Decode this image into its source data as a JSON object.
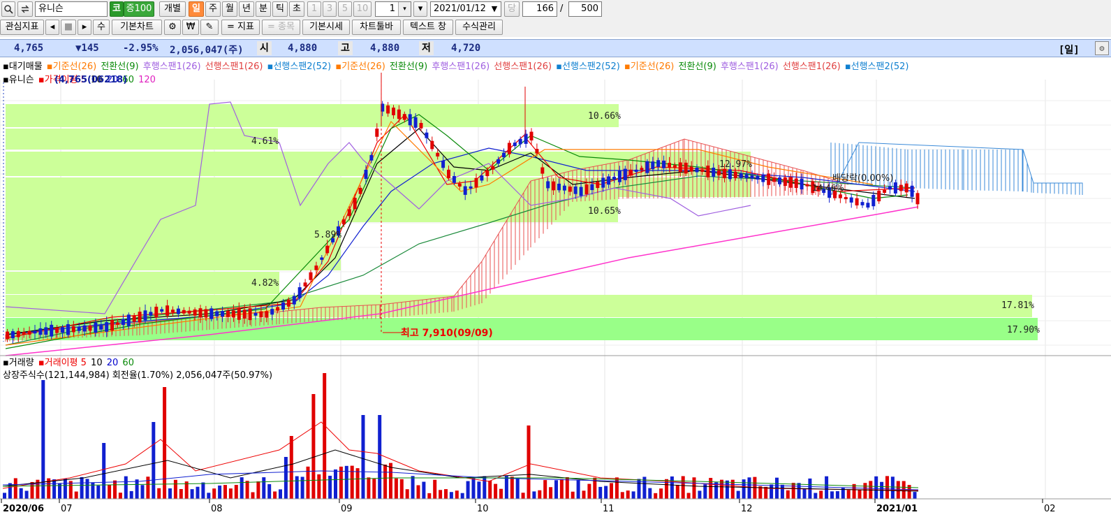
{
  "toolbar1": {
    "stock_name": "유니슨",
    "market_badge": "코",
    "margin_badge": "증100",
    "mode_label": "개별",
    "periods": [
      "일",
      "주",
      "월",
      "년",
      "분",
      "틱",
      "초"
    ],
    "tick_buttons": [
      "1",
      "3",
      "5",
      "10"
    ],
    "interval_value": "1",
    "date_value": "2021/01/12",
    "current_label": "당",
    "count_value": "166",
    "slash": "/",
    "total_value": "500"
  },
  "toolbar2": {
    "items": [
      "관심지표",
      "◂",
      "■",
      "▸",
      "수",
      "기본차트",
      "⚙",
      "₩",
      "🔧",
      "= 지표",
      "= 종목",
      "기본시세",
      "차트툴바",
      "텍스트 창",
      "수식관리"
    ]
  },
  "quote": {
    "price": "4,765",
    "change": "▼145",
    "change_rate": "-2.95%",
    "volume": "2,056,047(주)",
    "open_label": "시",
    "open": "4,880",
    "high_label": "고",
    "high": "4,880",
    "low_label": "저",
    "low": "4,720",
    "period_tag": "[일]"
  },
  "legend": {
    "line1": [
      "▪대기매물",
      "▪기준선(26)",
      "전환선(9)",
      "후행스팬1(26)",
      "선행스팬1(26)",
      "▪선행스팬2(52)",
      "▪기준선(26)",
      "전환선(9)",
      "후행스팬1(26)",
      "선행스팬1(26)",
      "▪선행스팬2(52)",
      "▪기준선(26)",
      "전환선(9)",
      "후행스팬1(26)",
      "선행스팬1(26)",
      "▪선행스팬2(52)"
    ],
    "line2": [
      "▪유니슨",
      "▪가격이평 5",
      "10",
      "20",
      "60",
      "120"
    ],
    "line2_overlay": "(4,765(06218)"
  },
  "volume_legend": {
    "line1": [
      "▪거래량",
      "▪거래이평 5",
      "10",
      "20",
      "60"
    ],
    "line2": "상장주식수(121,144,984) 회전율(1.70%) 2,056,047주(50.97%)"
  },
  "annotations": {
    "high_marker": "최고 7,910(09/09)",
    "dividend": "배당락(0.00%)",
    "overlay_pct": "14.46%"
  },
  "chart_data": {
    "type": "candlestick",
    "price_range": [
      4000,
      8000
    ],
    "volume_bands": [
      {
        "pct": "17.90%"
      },
      {
        "pct": "17.81%"
      },
      {
        "pct": "4.82%"
      },
      {
        "pct": "5.89%"
      },
      {
        "pct": "10.65%"
      },
      {
        "pct": "12.97%"
      },
      {
        "pct": "4.61%"
      },
      {
        "pct": "10.66%"
      }
    ],
    "x_axis_labels": [
      "2020/06",
      "07",
      "08",
      "09",
      "10",
      "11",
      "12",
      "2021/01",
      "02"
    ],
    "colors": {
      "up": "#e00000",
      "down": "#1020d0",
      "band": "#ccff99",
      "band_strong": "#99ff88",
      "cloud_up": "#e85050",
      "cloud_down": "#3a8ad8",
      "ma120": "#ff33cc"
    }
  }
}
